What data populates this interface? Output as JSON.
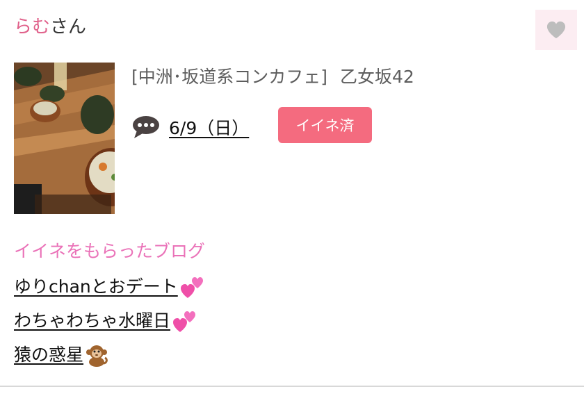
{
  "user": {
    "name": "らむ",
    "suffix": "さん"
  },
  "like_button": {
    "icon": "heart-icon",
    "color": "#bdbdbd",
    "background": "#fcedf2"
  },
  "post": {
    "thumbnail": "food-photo",
    "shop": "[中洲･坂道系コンカフェ]",
    "girl": "乙女坂42",
    "date": "6/9（日）",
    "comment_icon": "speech-bubble-icon",
    "badge": "イイネ済",
    "badge_color": "#f46b7f"
  },
  "liked_blogs": {
    "heading": "イイネをもらったブログ",
    "items": [
      {
        "title": "ゆりchanとおデート",
        "emoji": "two-hearts-emoji"
      },
      {
        "title": "わちゃわちゃ水曜日",
        "emoji": "two-hearts-emoji"
      },
      {
        "title": "猿の惑星",
        "emoji": "monkey-emoji"
      }
    ]
  }
}
